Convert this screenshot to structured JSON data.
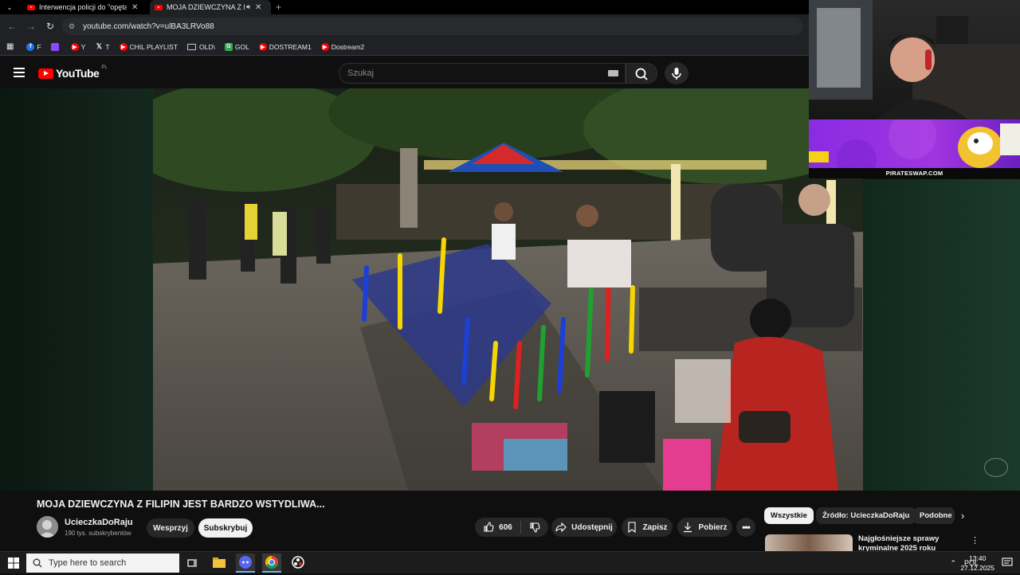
{
  "browser": {
    "tabs": [
      {
        "title": "Interwencja policji do \"opętane",
        "active": false
      },
      {
        "title": "MOJA DZIEWCZYNA Z FILIP",
        "active": true
      }
    ],
    "url": "youtube.com/watch?v=ulBA3LRVo88",
    "bookmarks": [
      {
        "label": "F",
        "icon": "facebook-icon",
        "color": "#1877f2"
      },
      {
        "label": "",
        "icon": "twitch-icon",
        "color": "#9146ff"
      },
      {
        "label": "Y",
        "icon": "youtube-icon",
        "color": "#ff0000"
      },
      {
        "label": "T",
        "icon": "x-icon",
        "color": "#000000"
      },
      {
        "label": "CHIL PLAYLIST",
        "icon": "youtube-icon",
        "color": "#ff0000"
      },
      {
        "label": "OLD\\",
        "icon": "folder-icon",
        "color": "#cccccc"
      },
      {
        "label": "GOL",
        "icon": "g-icon",
        "color": "#34a853"
      },
      {
        "label": "DOSTREAM1",
        "icon": "youtube-icon",
        "color": "#ff0000"
      },
      {
        "label": "Dostream2",
        "icon": "youtube-icon",
        "color": "#ff0000"
      }
    ]
  },
  "youtube": {
    "logo_text": "YouTube",
    "region": "PL",
    "search_placeholder": "Szukaj"
  },
  "video": {
    "title": "MOJA DZIEWCZYNA Z FILIPIN JEST BARDZO WSTYDLIWA...",
    "channel": "UcieczkaDoRaju",
    "subscribers": "190 tys. subskrybentów",
    "support_label": "Wesprzyj",
    "subscribe_label": "Subskrybuj",
    "likes": "606",
    "share_label": "Udostępnij",
    "save_label": "Zapisz",
    "download_label": "Pobierz"
  },
  "related": {
    "chips": [
      "Wszystkie",
      "Źródło: UcieczkaDoRaju",
      "Podobne"
    ],
    "first_title": "Najgłośniejsze sprawy kryminalne 2025 roku"
  },
  "overlay": {
    "ad_footer": "PIRATESWAP.COM",
    "ad_color": "#8a2be2"
  },
  "taskbar": {
    "search_placeholder": "Type here to search",
    "lang": "POL",
    "time": "13:40",
    "date": "27.12.2025"
  }
}
